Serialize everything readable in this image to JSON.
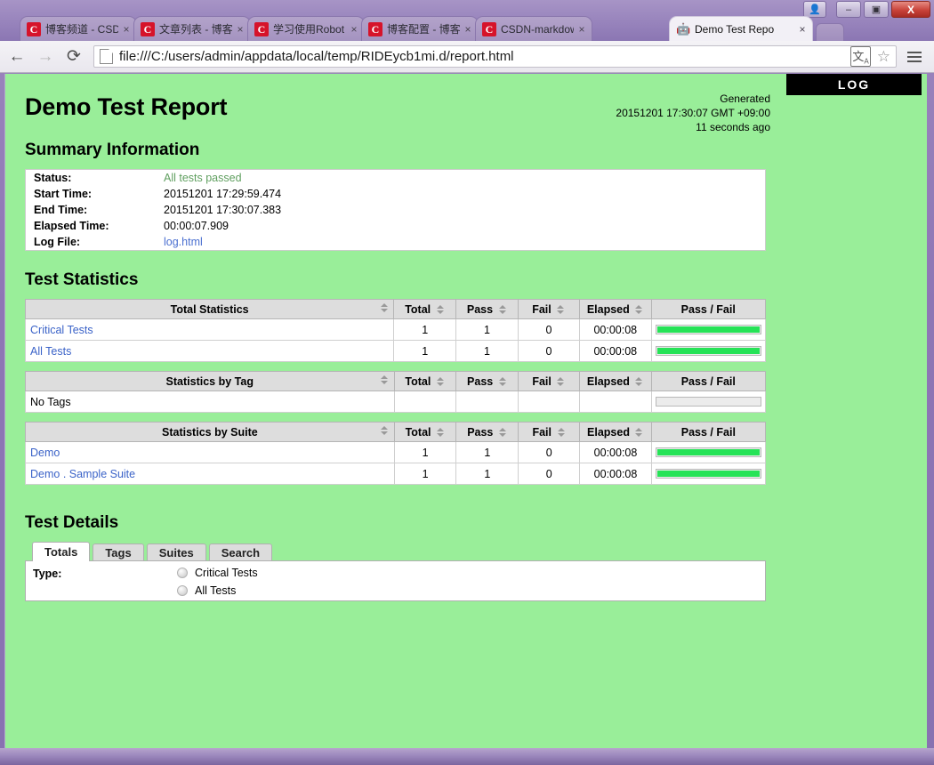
{
  "browser": {
    "window_buttons": {
      "user_icon": "user-icon",
      "minimize": "–",
      "maximize": "▣",
      "close": "X"
    },
    "tabs": [
      {
        "title": "博客频道 - CSDN",
        "favicon": "C",
        "favicon_kind": "csdn",
        "active": false,
        "close": "×"
      },
      {
        "title": "文章列表 - 博客频",
        "favicon": "C",
        "favicon_kind": "csdn",
        "active": false,
        "close": "×"
      },
      {
        "title": "学习使用Robot F",
        "favicon": "C",
        "favicon_kind": "csdn",
        "active": false,
        "close": "×"
      },
      {
        "title": "博客配置 - 博客频",
        "favicon": "C",
        "favicon_kind": "csdn",
        "active": false,
        "close": "×"
      },
      {
        "title": "CSDN-markdow",
        "favicon": "C",
        "favicon_kind": "csdn",
        "active": false,
        "close": "×"
      },
      {
        "title": "Demo Test Repo",
        "favicon": "🤖",
        "favicon_kind": "robot",
        "active": true,
        "close": "×"
      }
    ],
    "toolbar": {
      "back_icon": "back-arrow-icon",
      "forward_icon": "forward-arrow-icon",
      "reload_icon": "reload-icon",
      "url": "file:///C:/users/admin/appdata/local/temp/RIDEycb1mi.d/report.html",
      "translate_icon": "translate-icon",
      "bookmark_icon": "star-icon",
      "menu_icon": "hamburger-menu-icon"
    }
  },
  "report": {
    "title": "Demo Test Report",
    "log_button_label": "LOG",
    "generated": {
      "label": "Generated",
      "timestamp": "20151201 17:30:07 GMT +09:00",
      "relative": "11 seconds ago"
    },
    "summary": {
      "heading": "Summary Information",
      "rows": [
        {
          "key": "Status:",
          "value": "All tests passed",
          "style": "pass"
        },
        {
          "key": "Start Time:",
          "value": "20151201 17:29:59.474",
          "style": "plain"
        },
        {
          "key": "End Time:",
          "value": "20151201 17:30:07.383",
          "style": "plain"
        },
        {
          "key": "Elapsed Time:",
          "value": "00:00:07.909",
          "style": "plain"
        },
        {
          "key": "Log File:",
          "value": "log.html",
          "style": "link"
        }
      ]
    },
    "statistics": {
      "heading": "Test Statistics",
      "columns": {
        "total": "Total",
        "pass": "Pass",
        "fail": "Fail",
        "elapsed": "Elapsed",
        "graph": "Pass / Fail"
      },
      "tables": [
        {
          "name_header": "Total Statistics",
          "rows": [
            {
              "name": "Critical Tests",
              "link": true,
              "total": "1",
              "pass": "1",
              "fail": "0",
              "elapsed": "00:00:08",
              "pass_pct": 100
            },
            {
              "name": "All Tests",
              "link": true,
              "total": "1",
              "pass": "1",
              "fail": "0",
              "elapsed": "00:00:08",
              "pass_pct": 100
            }
          ]
        },
        {
          "name_header": "Statistics by Tag",
          "rows": [
            {
              "name": "No Tags",
              "link": false,
              "total": "",
              "pass": "",
              "fail": "",
              "elapsed": "",
              "pass_pct": 0
            }
          ]
        },
        {
          "name_header": "Statistics by Suite",
          "rows": [
            {
              "name": "Demo",
              "link": true,
              "total": "1",
              "pass": "1",
              "fail": "0",
              "elapsed": "00:00:08",
              "pass_pct": 100
            },
            {
              "name": "Demo . Sample Suite",
              "link": true,
              "total": "1",
              "pass": "1",
              "fail": "0",
              "elapsed": "00:00:08",
              "pass_pct": 100
            }
          ]
        }
      ]
    },
    "details": {
      "heading": "Test Details",
      "tabs": [
        {
          "label": "Totals",
          "active": true
        },
        {
          "label": "Tags",
          "active": false
        },
        {
          "label": "Suites",
          "active": false
        },
        {
          "label": "Search",
          "active": false
        }
      ],
      "type_label": "Type:",
      "radios": [
        {
          "label": "Critical Tests",
          "checked": false
        },
        {
          "label": "All Tests",
          "checked": false
        }
      ]
    }
  },
  "colors": {
    "page_background": "#99EE99",
    "pass_bar": "#26e357",
    "log_button_bg": "#000000",
    "link": "#3b63c8",
    "status_pass_text": "#5f9f5f"
  }
}
